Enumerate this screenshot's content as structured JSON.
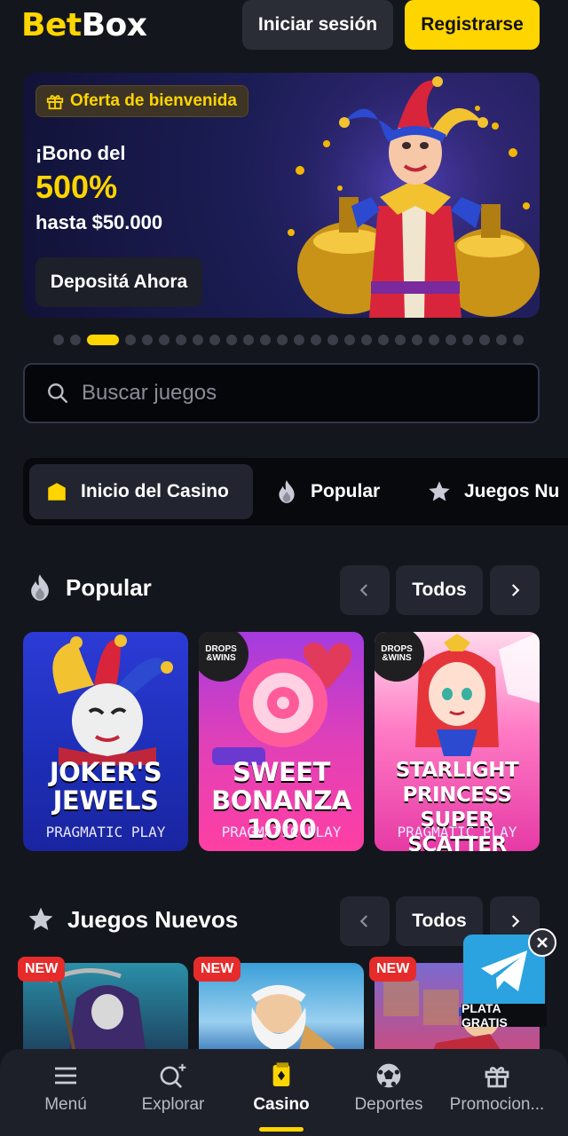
{
  "header": {
    "logo_part1": "Bet",
    "logo_part2": "Box",
    "login_label": "Iniciar sesión",
    "register_label": "Registrarse"
  },
  "banner": {
    "badge": "Oferta de bienvenida",
    "line1": "¡Bono del",
    "big": "500%",
    "line3": "hasta $50.000",
    "cta": "Depositá Ahora",
    "carousel": {
      "total": 27,
      "active_index": 2
    }
  },
  "search": {
    "placeholder": "Buscar juegos",
    "icon": "search-icon"
  },
  "categories": [
    {
      "label": "Inicio del Casino",
      "icon": "home-icon",
      "active": true
    },
    {
      "label": "Popular",
      "icon": "flame-icon",
      "active": false
    },
    {
      "label": "Juegos Nu",
      "icon": "star-icon",
      "active": false
    }
  ],
  "popular": {
    "title": "Popular",
    "all_label": "Todos",
    "games": [
      {
        "title": "JOKER'S JEWELS",
        "provider": "PRAGMATIC PLAY",
        "drops": false
      },
      {
        "title": "SWEET BONANZA 1000",
        "provider": "PRAGMATIC PLAY",
        "drops": true
      },
      {
        "title": "STARLIGHT PRINCESS SUPER SCATTER",
        "provider": "PRAGMATIC PLAY",
        "drops": true
      }
    ],
    "drops_label_1": "DROPS",
    "drops_label_2": "&WINS"
  },
  "new_games": {
    "title": "Juegos Nuevos",
    "all_label": "Todos",
    "tag": "NEW"
  },
  "telegram": {
    "label": "PLATA GRATIS"
  },
  "bottom_nav": [
    {
      "label": "Menú",
      "icon": "menu-icon"
    },
    {
      "label": "Explorar",
      "icon": "explore-icon"
    },
    {
      "label": "Casino",
      "icon": "casino-icon",
      "active": true
    },
    {
      "label": "Deportes",
      "icon": "soccer-ball-icon"
    },
    {
      "label": "Promocion...",
      "icon": "gift-icon"
    }
  ],
  "colors": {
    "accent": "#ffd500",
    "background": "#14161d",
    "new_tag": "#e62b2b",
    "telegram": "#2aa3e0"
  }
}
